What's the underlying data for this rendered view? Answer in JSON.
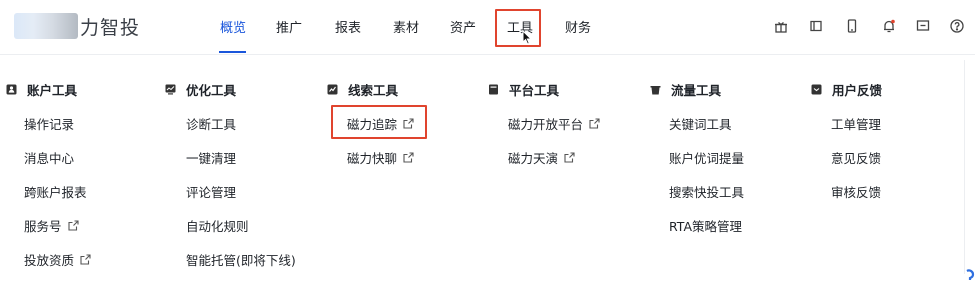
{
  "logo": {
    "text": "力智投"
  },
  "nav": {
    "items": [
      "概览",
      "推广",
      "报表",
      "素材",
      "资产",
      "工具",
      "财务"
    ],
    "active_index": 0,
    "highlighted_index": 5
  },
  "header_icons": [
    "gift-icon",
    "book-icon",
    "mobile-icon",
    "bell-icon",
    "message-icon",
    "help-icon"
  ],
  "menu": {
    "columns": [
      {
        "title": "账户工具",
        "icon": "account-icon",
        "items": [
          {
            "label": "操作记录",
            "external": false
          },
          {
            "label": "消息中心",
            "external": false
          },
          {
            "label": "跨账户报表",
            "external": false
          },
          {
            "label": "服务号",
            "external": true
          },
          {
            "label": "投放资质",
            "external": true
          }
        ]
      },
      {
        "title": "优化工具",
        "icon": "optimize-icon",
        "items": [
          {
            "label": "诊断工具",
            "external": false
          },
          {
            "label": "一键清理",
            "external": false
          },
          {
            "label": "评论管理",
            "external": false
          },
          {
            "label": "自动化规则",
            "external": false
          },
          {
            "label": "智能托管(即将下线)",
            "external": false
          }
        ]
      },
      {
        "title": "线索工具",
        "icon": "leads-icon",
        "items": [
          {
            "label": "磁力追踪",
            "external": true
          },
          {
            "label": "磁力快聊",
            "external": true
          }
        ]
      },
      {
        "title": "平台工具",
        "icon": "platform-icon",
        "items": [
          {
            "label": "磁力开放平台",
            "external": true
          },
          {
            "label": "磁力天演",
            "external": true
          }
        ]
      },
      {
        "title": "流量工具",
        "icon": "traffic-icon",
        "items": [
          {
            "label": "关键词工具",
            "external": false
          },
          {
            "label": "账户优词提量",
            "external": false
          },
          {
            "label": "搜索快投工具",
            "external": false
          },
          {
            "label": "RTA策略管理",
            "external": false
          }
        ]
      },
      {
        "title": "用户反馈",
        "icon": "feedback-icon",
        "items": [
          {
            "label": "工单管理",
            "external": false
          },
          {
            "label": "意见反馈",
            "external": false
          },
          {
            "label": "审核反馈",
            "external": false
          }
        ]
      }
    ]
  },
  "colors": {
    "accent": "#1a56db",
    "highlight": "#e0442e",
    "text": "#1f2329"
  }
}
